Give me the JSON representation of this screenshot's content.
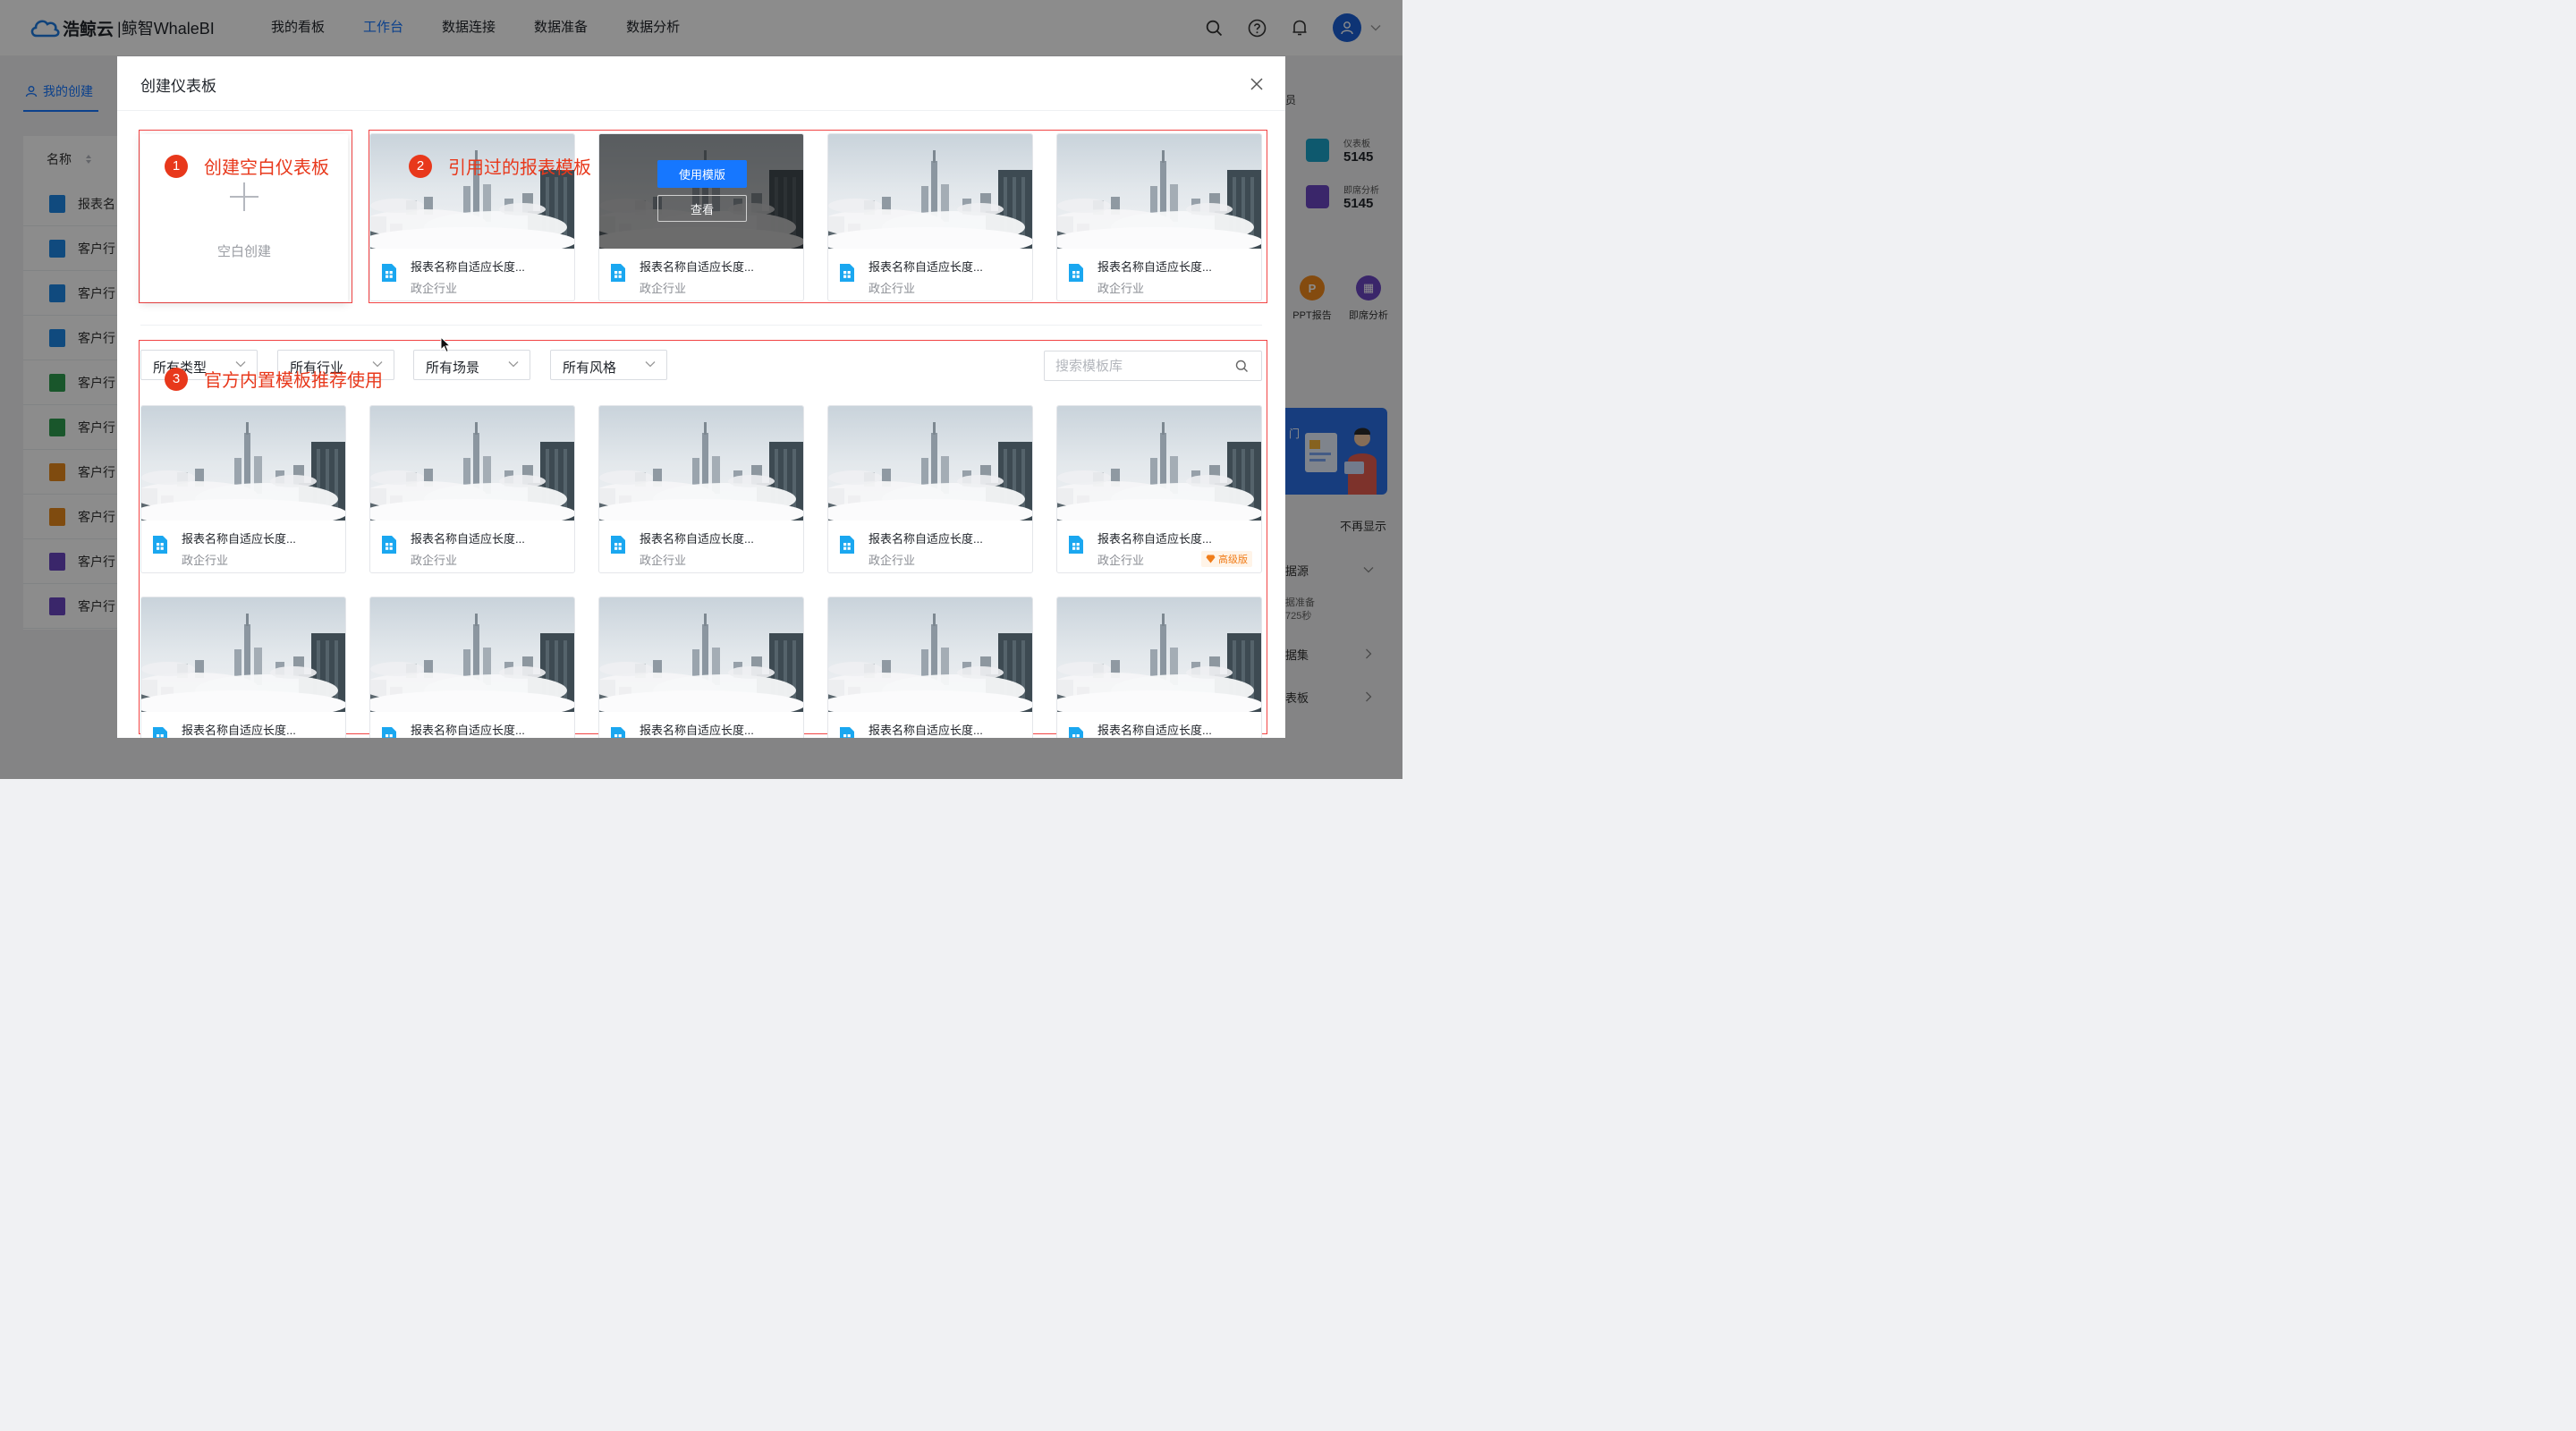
{
  "topnav": {
    "logo_main": "浩鲸云",
    "logo_sub": "|鲸智WhaleBI",
    "items": [
      {
        "label": "我的看板",
        "active": false
      },
      {
        "label": "工作台",
        "active": true
      },
      {
        "label": "数据连接",
        "active": false
      },
      {
        "label": "数据准备",
        "active": false
      },
      {
        "label": "数据分析",
        "active": false
      }
    ],
    "icons": [
      "search-icon",
      "help-icon",
      "bell-icon",
      "user-icon",
      "chevron-down-icon"
    ],
    "accent": "#1677ff"
  },
  "background": {
    "tab_label": "我的创建",
    "column_header": "名称",
    "rows": [
      {
        "label": "报表名",
        "color": "#1e88e5"
      },
      {
        "label": "客户行",
        "color": "#1e88e5"
      },
      {
        "label": "客户行",
        "color": "#1e88e5"
      },
      {
        "label": "客户行",
        "color": "#1e88e5"
      },
      {
        "label": "客户行",
        "color": "#2e9d4f"
      },
      {
        "label": "客户行",
        "color": "#2e9d4f"
      },
      {
        "label": "客户行",
        "color": "#e8891d"
      },
      {
        "label": "客户行",
        "color": "#e8891d"
      },
      {
        "label": "客户行",
        "color": "#6b46c1"
      },
      {
        "label": "客户行",
        "color": "#6b46c1"
      }
    ],
    "right": {
      "fragment_top": "员",
      "stats": [
        {
          "label": "仪表板",
          "value": "5145",
          "color": "#1aa3c9"
        },
        {
          "label": "即席分析",
          "value": "5145",
          "color": "#6b46c1"
        }
      ],
      "quick": [
        {
          "label": "PPT报告",
          "color": "#f0891d"
        },
        {
          "label": "即席分析",
          "color": "#6b46c1"
        }
      ],
      "promo_fragment": "门",
      "dismiss": "不再显示",
      "sections": [
        {
          "label": "据源",
          "sub": "据准备",
          "sub2": "725秒"
        },
        {
          "label": "据集"
        },
        {
          "label": "表板"
        }
      ]
    }
  },
  "modal": {
    "title": "创建仪表板",
    "blank_label": "空白创建",
    "annotations": [
      {
        "num": "1",
        "text": "创建空白仪表板"
      },
      {
        "num": "2",
        "text": "引用过的报表模板"
      },
      {
        "num": "3",
        "text": "官方内置模板推荐使用"
      }
    ],
    "hover_actions": {
      "use": "使用模版",
      "view": "查看"
    },
    "recent_templates": [
      {
        "name": "报表名称自适应长度...",
        "industry": "政企行业"
      },
      {
        "name": "报表名称自适应长度...",
        "industry": "政企行业"
      },
      {
        "name": "报表名称自适应长度...",
        "industry": "政企行业"
      },
      {
        "name": "报表名称自适应长度...",
        "industry": "政企行业"
      }
    ],
    "filters": [
      "所有类型",
      "所有行业",
      "所有场景",
      "所有风格"
    ],
    "search_placeholder": "搜索模板库",
    "premium_badge": "高级版",
    "official_templates": [
      {
        "name": "报表名称自适应长度...",
        "industry": "政企行业"
      },
      {
        "name": "报表名称自适应长度...",
        "industry": "政企行业"
      },
      {
        "name": "报表名称自适应长度...",
        "industry": "政企行业"
      },
      {
        "name": "报表名称自适应长度...",
        "industry": "政企行业"
      },
      {
        "name": "报表名称自适应长度...",
        "industry": "政企行业"
      },
      {
        "name": "报表名称自适应长度...",
        "industry": ""
      },
      {
        "name": "报表名称自适应长度...",
        "industry": ""
      },
      {
        "name": "报表名称自适应长度...",
        "industry": ""
      },
      {
        "name": "报表名称自适应长度...",
        "industry": ""
      },
      {
        "name": "报表名称自适应长度...",
        "industry": ""
      }
    ]
  }
}
